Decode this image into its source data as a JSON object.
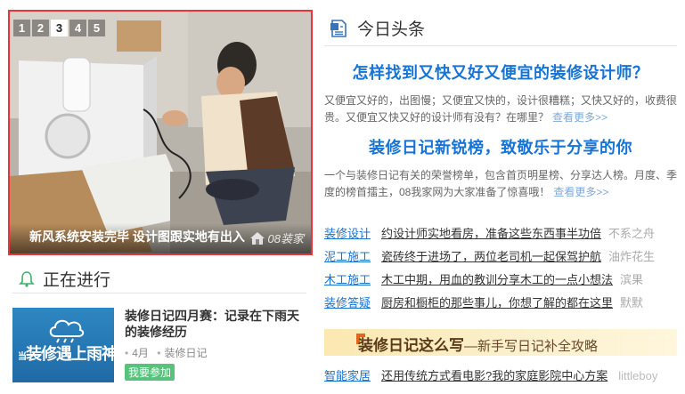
{
  "slider": {
    "pages": [
      "1",
      "2",
      "3",
      "4",
      "5"
    ],
    "active_page": 3,
    "caption": "新风系统安装完毕 设计图跟实地有出入",
    "watermark": "08装家"
  },
  "in_progress": {
    "title": "正在进行",
    "card": {
      "thumb_text": "装修遇上雨神",
      "thumb_prefix": "当",
      "title": "装修日记四月赛：记录在下雨天的装修经历",
      "month": "4月",
      "category": "装修日记",
      "join_label": "我要参加"
    }
  },
  "headlines": {
    "title": "今日头条",
    "features": [
      {
        "title": "怎样找到又快又好又便宜的装修设计师？",
        "desc": "又便宜又好的，出图慢；又便宜又快的，设计很糟糕；又快又好的，收费很贵。又便宜又快又好的设计师有没有？在哪里？",
        "more": "查看更多>>"
      },
      {
        "title": "装修日记新锐榜，致敬乐于分享的你",
        "desc": "一个与装修日记有关的荣誉榜单，包含首页明星榜、分享达人榜。月度、季度的榜首擂主，08我家网为大家准备了惊喜哦！",
        "more": "查看更多>>"
      }
    ],
    "list": [
      {
        "category": "装修设计",
        "text": "约设计师实地看房，准备这些东西事半功倍",
        "extra": "不系之舟"
      },
      {
        "category": "泥工施工",
        "text": "瓷砖终于进场了，两位老司机一起保驾护航",
        "extra": "油炸花生"
      },
      {
        "category": "木工施工",
        "text": "木工中期，用血的教训分享木工的一点小想法",
        "extra": "滨果"
      },
      {
        "category": "装修答疑",
        "text": "厨房和橱柜的那些事儿，你想了解的都在这里",
        "extra": "默默"
      }
    ],
    "banner": {
      "main": "装修日记这么写",
      "sub": "—新手写日记补全攻略"
    },
    "bottom": {
      "category": "智能家居",
      "text": "还用传统方式看电影?我的家庭影院中心方案",
      "extra": "littleboy"
    }
  }
}
